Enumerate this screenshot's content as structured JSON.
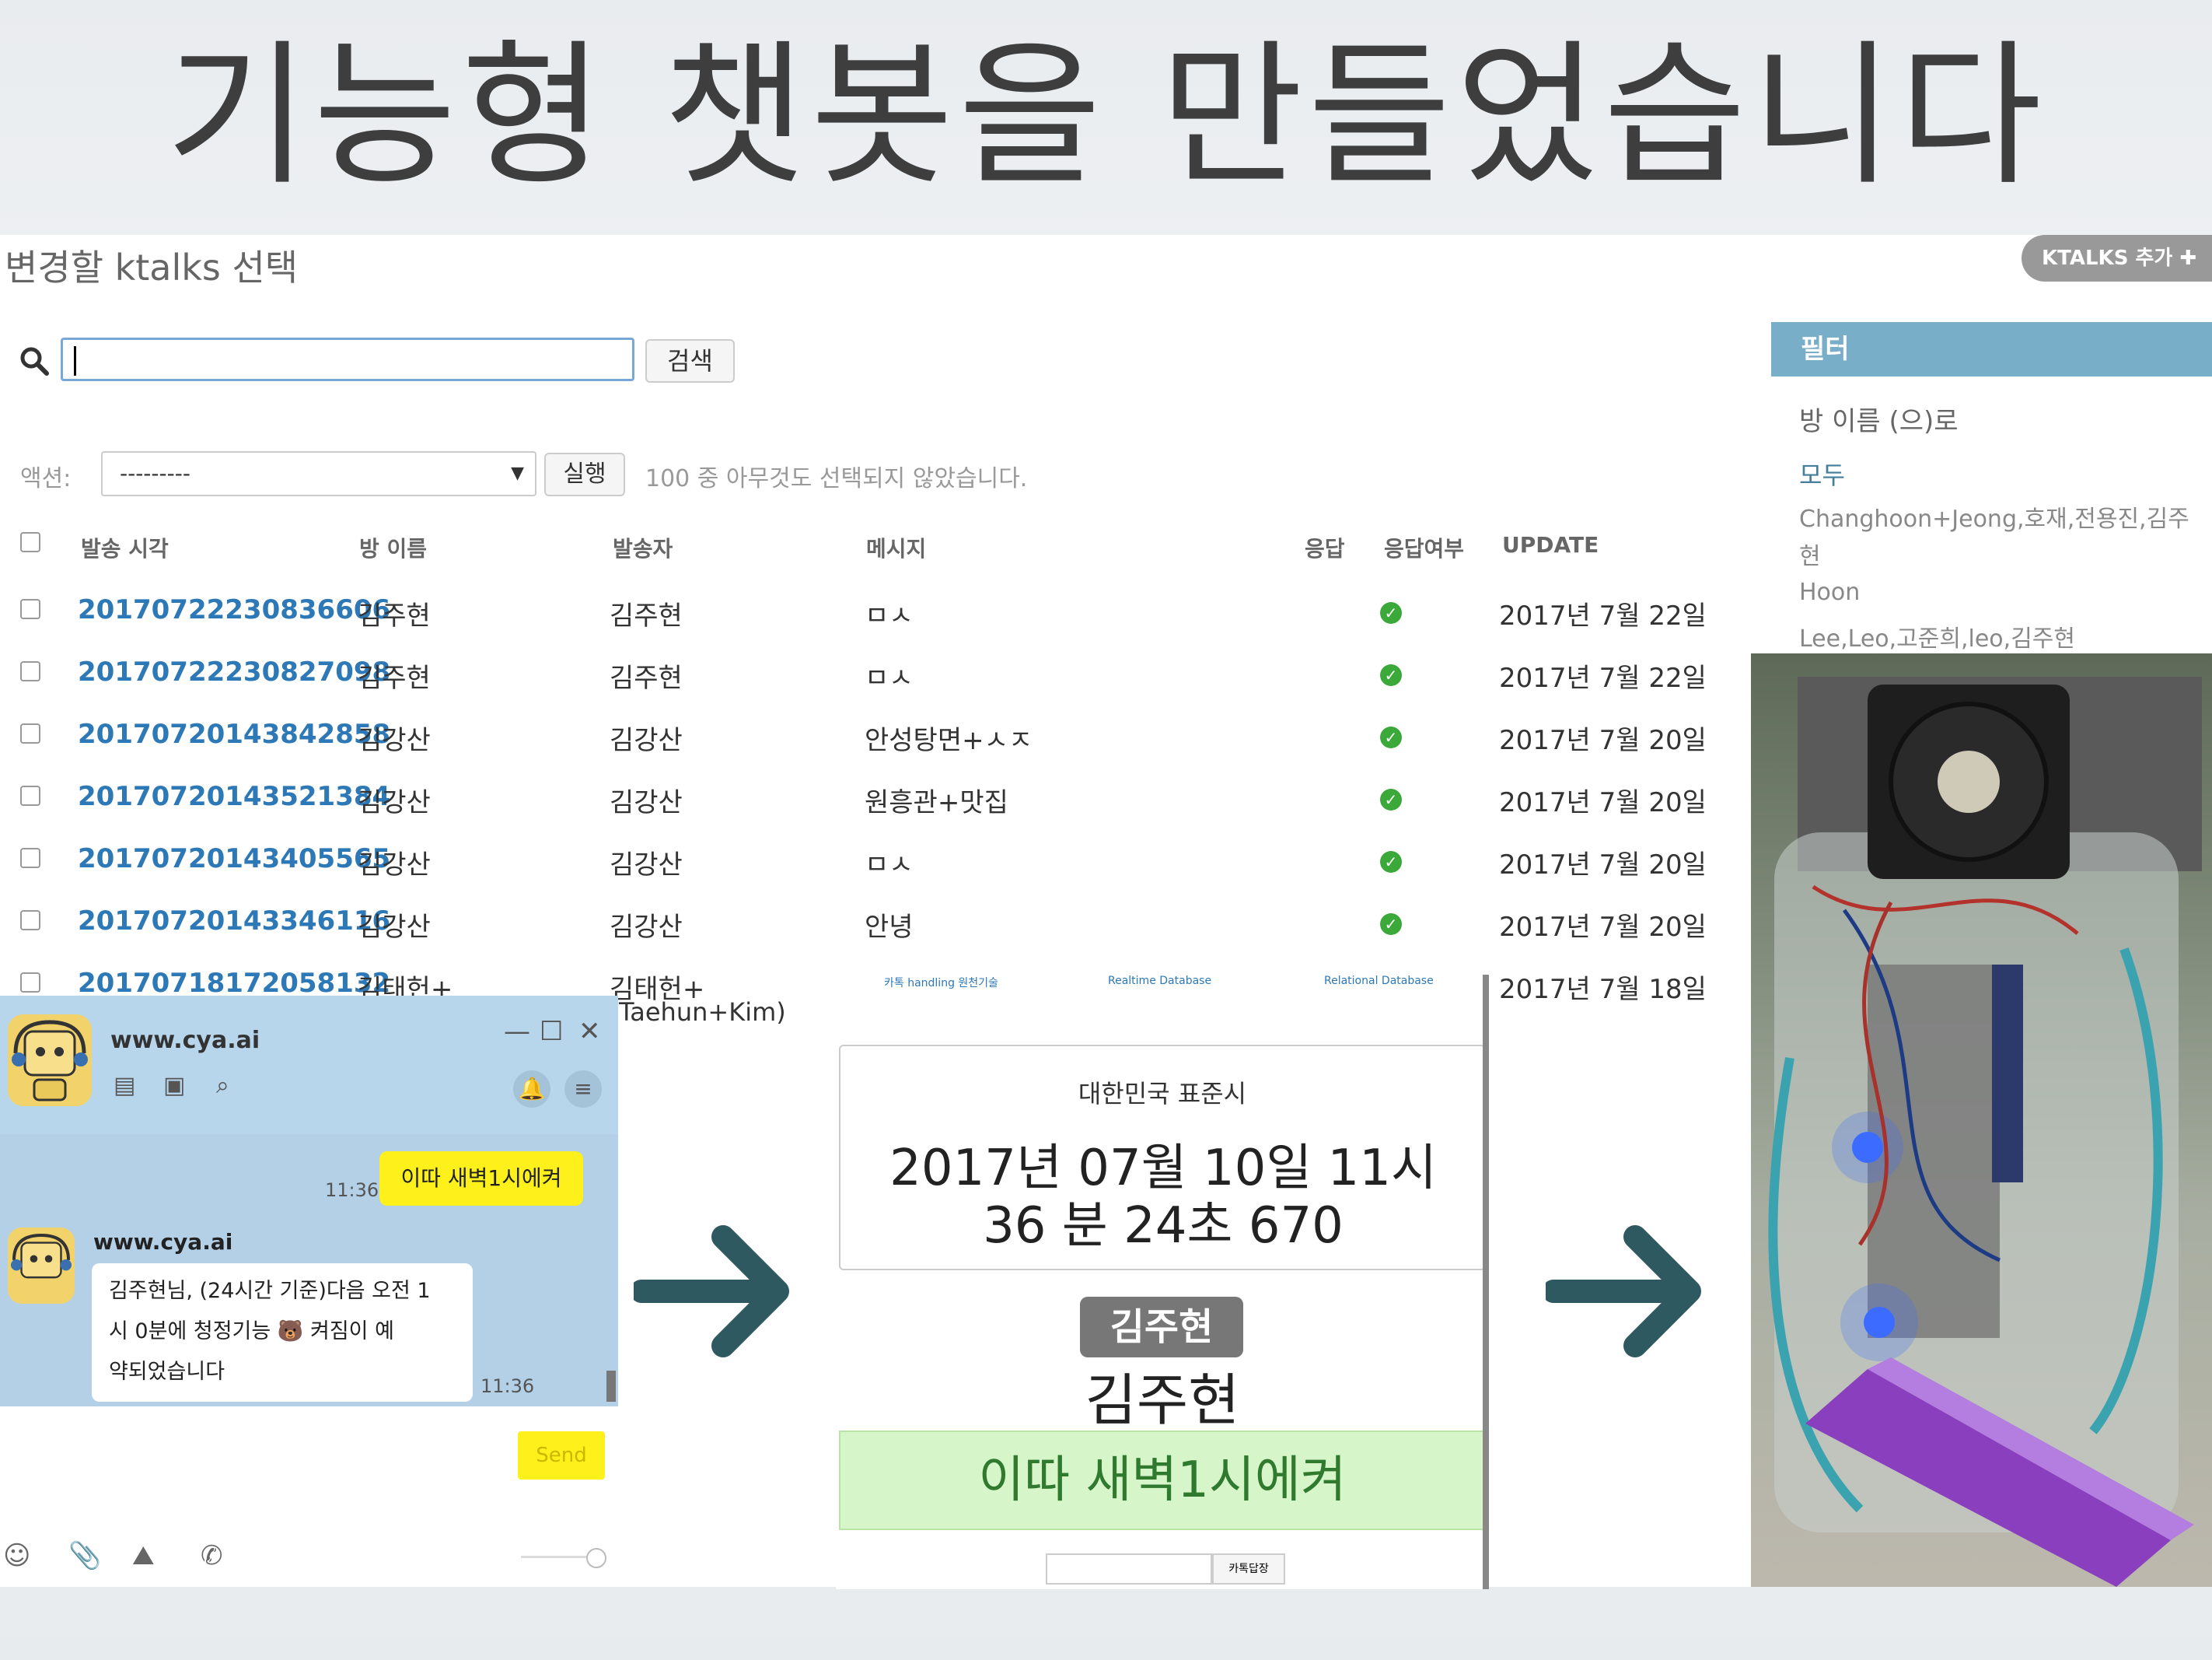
{
  "slide": {
    "title": "기능형 챗봇을 만들었습니다"
  },
  "admin": {
    "heading": "변경할 ktalks 선택",
    "add_button": "KTALKS 추가 ✚",
    "search": {
      "value": "",
      "button": "검색"
    },
    "action": {
      "label": "액션:",
      "selected": "---------",
      "run_button": "실행",
      "count_text": "100 중 아무것도 선택되지 않았습니다."
    },
    "columns": [
      "발송 시각",
      "방 이름",
      "발송자",
      "메시지",
      "응답",
      "응답여부",
      "UPDATE"
    ],
    "rows": [
      {
        "id": "20170722230836606",
        "room": "김주현",
        "sender": "김주현",
        "message": "ㅁㅅ",
        "update": "2017년 7월 22일"
      },
      {
        "id": "20170722230827098",
        "room": "김주현",
        "sender": "김주현",
        "message": "ㅁㅅ",
        "update": "2017년 7월 22일"
      },
      {
        "id": "20170720143842858",
        "room": "김강산",
        "sender": "김강산",
        "message": "안성탕면+ㅅㅈ",
        "update": "2017년 7월 20일"
      },
      {
        "id": "20170720143521384",
        "room": "김강산",
        "sender": "김강산",
        "message": "원흥관+맛집",
        "update": "2017년 7월 20일"
      },
      {
        "id": "20170720143405565",
        "room": "김강산",
        "sender": "김강산",
        "message": "ㅁㅅ",
        "update": "2017년 7월 20일"
      },
      {
        "id": "20170720143346116",
        "room": "김강산",
        "sender": "김강산",
        "message": "안녕",
        "update": "2017년 7월 20일"
      },
      {
        "id": "20170718172058132",
        "room": "김태헌+",
        "sender": "김태헌+",
        "sender_line2": "Taehun+Kim)",
        "message": "",
        "update": "2017년 7월 18일"
      }
    ],
    "filter": {
      "header": "필터",
      "subheading": "방 이름 (으)로",
      "items": [
        "모두",
        "Changhoon+Jeong,호재,전용진,김주",
        "현",
        "Hoon",
        "Lee,Leo,고준희,leo,김주현"
      ]
    }
  },
  "messenger": {
    "name": "www.cya.ai",
    "my_message": "이따 새벽1시에켜",
    "my_time": "11:36",
    "bot_name": "www.cya.ai",
    "bot_message": "김주현님, (24시간 기준)다음 오전 1\n시 0분에 청정기능 🐻 켜짐이 예\n약되었습니다",
    "bot_time": "11:36",
    "send_button": "Send"
  },
  "clock_panel": {
    "top_links": [
      "카톡 handling 원천기술",
      "Realtime Database",
      "Relational Database"
    ],
    "timezone": "대한민국 표준시",
    "time_text": "2017년 07월 10일 11시 36 분 24초 670",
    "name_badge": "김주현",
    "name": "김주현",
    "message": "이따 새벽1시에켜",
    "reply_button": "카톡답장"
  },
  "colors": {
    "arrow": "#2e5961",
    "link": "#2d78b6",
    "filter_header": "#79aec8",
    "kakao_yellow": "#fef01b",
    "success": "#3aa93a"
  }
}
